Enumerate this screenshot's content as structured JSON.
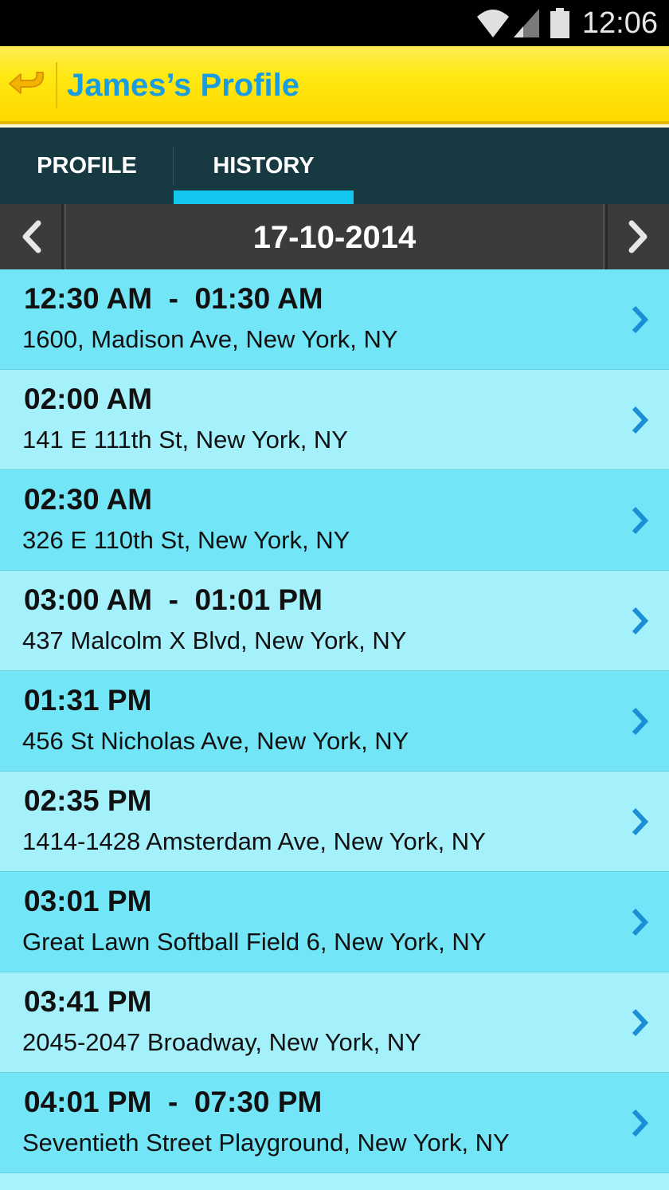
{
  "status_bar": {
    "time": "12:06",
    "icons": [
      "wifi-icon",
      "signal-icon",
      "battery-icon"
    ]
  },
  "action_bar": {
    "title": "James’s Profile",
    "back_icon": "back-arrow-icon",
    "bg_color": "#ffe500",
    "title_color": "#1a9ce0"
  },
  "tabs": [
    {
      "label": "PROFILE",
      "selected": false
    },
    {
      "label": "HISTORY",
      "selected": true
    }
  ],
  "tab_indicator_color": "#12c6ee",
  "date_nav": {
    "date": "17-10-2014",
    "prev_icon": "chevron-left-icon",
    "next_icon": "chevron-right-icon"
  },
  "history": [
    {
      "time": "12:30 AM  -  01:30 AM",
      "address": "1600, Madison Ave, New York, NY"
    },
    {
      "time": "02:00 AM",
      "address": "141 E 111th St, New York, NY"
    },
    {
      "time": "02:30 AM",
      "address": "326 E 110th St, New York, NY"
    },
    {
      "time": "03:00 AM  -  01:01 PM",
      "address": "437 Malcolm X Blvd, New York, NY"
    },
    {
      "time": "01:31 PM",
      "address": "456 St Nicholas Ave, New York, NY"
    },
    {
      "time": "02:35 PM",
      "address": "1414-1428 Amsterdam Ave, New York, NY"
    },
    {
      "time": "03:01 PM",
      "address": "Great Lawn Softball Field 6, New York, NY"
    },
    {
      "time": "03:41 PM",
      "address": "2045-2047 Broadway, New York, NY"
    },
    {
      "time": "04:01 PM  -  07:30 PM",
      "address": "Seventieth Street Playground, New York, NY"
    }
  ],
  "row_colors": {
    "odd": "#72e5f7",
    "even": "#a4f1fc",
    "chevron": "#1a8fd6"
  }
}
